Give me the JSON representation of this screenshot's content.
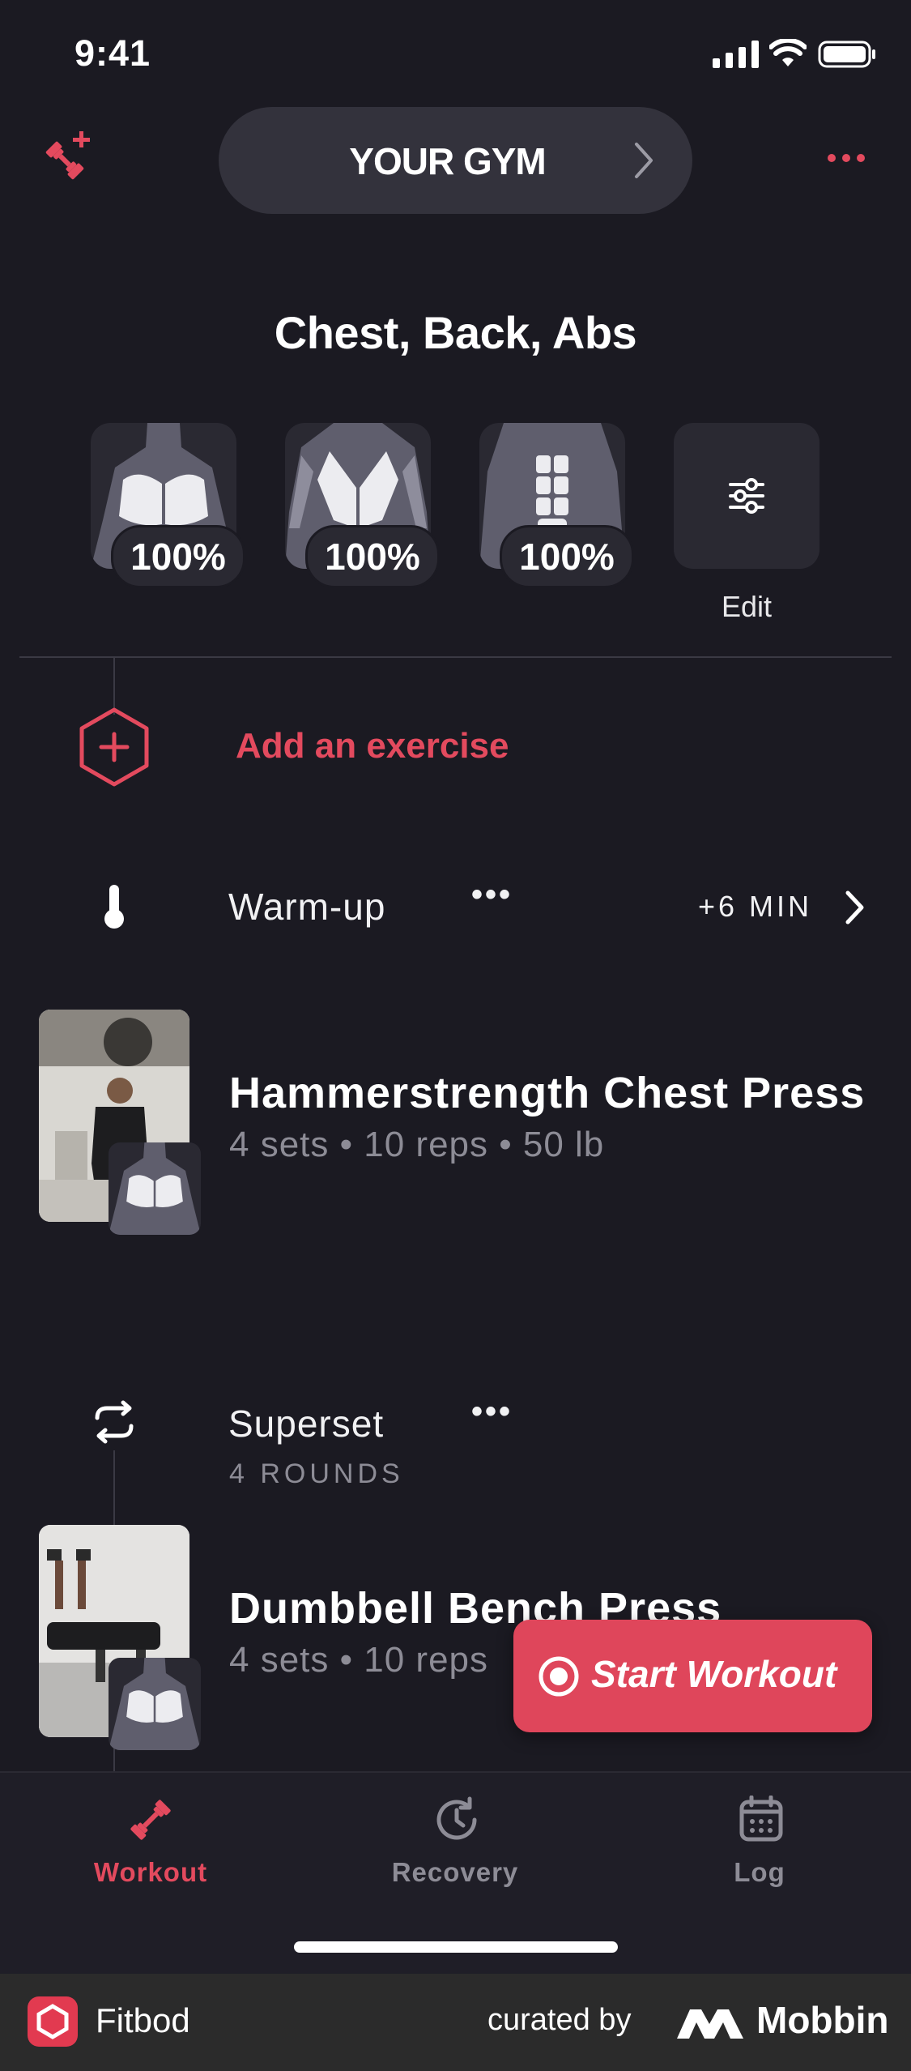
{
  "status_bar": {
    "time": "9:41"
  },
  "header": {
    "gym_label": "YOUR GYM"
  },
  "workout": {
    "title": "Chest, Back, Abs",
    "muscles": [
      {
        "name": "chest",
        "percent": "100%"
      },
      {
        "name": "back",
        "percent": "100%"
      },
      {
        "name": "abs",
        "percent": "100%"
      }
    ],
    "edit_label": "Edit",
    "add_exercise_label": "Add an exercise",
    "warmup": {
      "label": "Warm-up",
      "duration": "+6 MIN"
    },
    "exercises": [
      {
        "name": "Hammerstrength Chest Press",
        "meta": "4 sets • 10 reps • 50 lb"
      }
    ],
    "superset": {
      "label": "Superset",
      "rounds": "4 ROUNDS",
      "exercises": [
        {
          "name": "Dumbbell Bench Press",
          "meta": "4 sets • 10 reps"
        }
      ]
    },
    "start_button_label": "Start Workout"
  },
  "tabs": [
    {
      "label": "Workout",
      "icon": "dumbbell-icon",
      "active": true
    },
    {
      "label": "Recovery",
      "icon": "recovery-clock-icon",
      "active": false
    },
    {
      "label": "Log",
      "icon": "calendar-icon",
      "active": false
    }
  ],
  "footer": {
    "app_name": "Fitbod",
    "curated_by": "curated by",
    "brand": "Mobbin"
  },
  "colors": {
    "accent": "#e34a5e",
    "background": "#1b1a22",
    "card": "#2a2932"
  }
}
